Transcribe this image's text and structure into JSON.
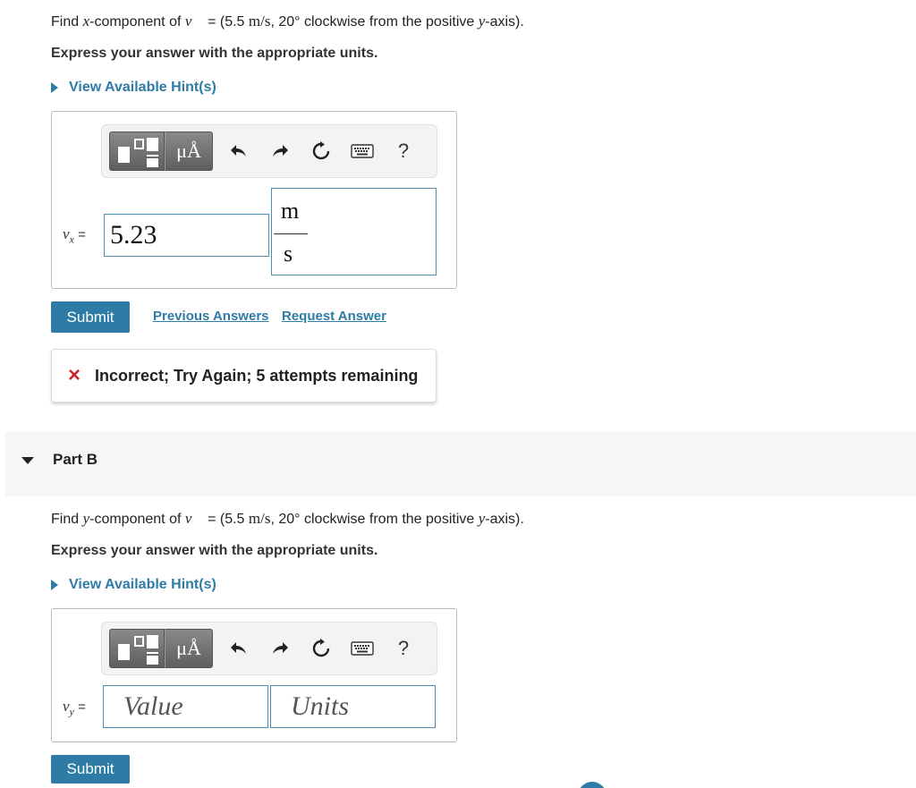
{
  "partA": {
    "question_prefix": "Find ",
    "question_var": "x",
    "question_mid": "-component of ",
    "vector_symbol": "v⃗",
    "question_eq": " = (5.5 ",
    "question_unit": "m/s",
    "question_suffix": ", 20° clockwise from the positive ",
    "axis_var": "y",
    "axis_suffix": "-axis).",
    "instruction": "Express your answer with the appropriate units.",
    "hint_label": "View Available Hint(s)",
    "toolbar": {
      "templates_icon": "templates-icon",
      "symbols_label": "μÅ",
      "undo_icon": "undo-icon",
      "redo_icon": "redo-icon",
      "reset_icon": "reset-icon",
      "keyboard_icon": "keyboard-icon",
      "help_label": "?"
    },
    "var_label": "v",
    "var_sub": "x",
    "equals": "=",
    "value": "5.23",
    "unit_numerator": "m",
    "unit_denominator": "s",
    "submit_label": "Submit",
    "previous_answers_label": "Previous Answers",
    "request_answer_label": "Request Answer",
    "feedback_icon": "×",
    "feedback_message": "Incorrect; Try Again; 5 attempts remaining"
  },
  "partB": {
    "title": "Part B",
    "question_prefix": "Find ",
    "question_var": "y",
    "question_mid": "-component of ",
    "vector_symbol": "v⃗",
    "question_eq": " = (5.5 ",
    "question_unit": "m/s",
    "question_suffix": ", 20° clockwise from the positive ",
    "axis_var": "y",
    "axis_suffix": "-axis).",
    "instruction": "Express your answer with the appropriate units.",
    "hint_label": "View Available Hint(s)",
    "toolbar": {
      "symbols_label": "μÅ",
      "help_label": "?"
    },
    "var_label": "v",
    "var_sub": "y",
    "equals": "=",
    "value_placeholder": "Value",
    "units_placeholder": "Units",
    "submit_label": "Submit"
  },
  "colors": {
    "accent": "#2e7ca6",
    "error": "#d2232a",
    "field_border": "#4a8fb1"
  }
}
